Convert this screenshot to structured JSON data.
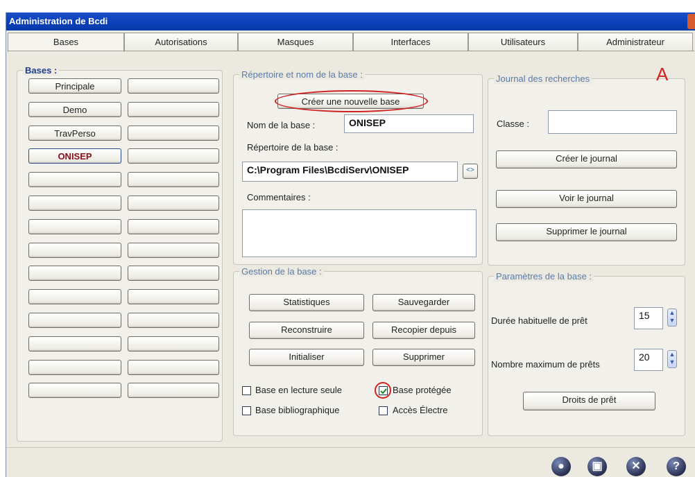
{
  "window": {
    "title": "Administration de Bcdi"
  },
  "tabs": [
    "Bases",
    "Autorisations",
    "Masques",
    "Interfaces",
    "Utilisateurs",
    "Administrateur"
  ],
  "bases_group": {
    "legend": "Bases :",
    "col1": [
      "Principale",
      "Demo",
      "TravPerso",
      "ONISEP",
      "",
      "",
      "",
      "",
      "",
      "",
      "",
      "",
      "",
      ""
    ],
    "selected": "ONISEP"
  },
  "repertoire": {
    "legend": "Répertoire et nom de la base :",
    "create_button": "Créer une nouvelle base",
    "name_label": "Nom de la base :",
    "name_value": "ONISEP",
    "dir_label": "Répertoire de la base :",
    "dir_value": "C:\\Program Files\\BcdiServ\\ONISEP",
    "browse_button": "<>",
    "comments_label": "Commentaires :",
    "comments_value": ""
  },
  "gestion": {
    "legend": "Gestion de la base :",
    "buttons": [
      "Statistiques",
      "Sauvegarder",
      "Reconstruire",
      "Recopier depuis",
      "Initialiser",
      "Supprimer"
    ],
    "checkboxes": [
      {
        "label": "Base en lecture seule",
        "checked": false
      },
      {
        "label": "Base protégée",
        "checked": true
      },
      {
        "label": "Base bibliographique",
        "checked": false
      },
      {
        "label": "Accès Électre",
        "checked": false
      }
    ]
  },
  "journal": {
    "legend": "Journal des recherches",
    "annotation": "A",
    "classe_label": "Classe :",
    "classe_value": "",
    "buttons": [
      "Créer le journal",
      "Voir le journal",
      "Supprimer le journal"
    ]
  },
  "parametres": {
    "legend": "Paramètres de la base :",
    "duree_label": "Durée habituelle de prêt",
    "duree_value": "15",
    "max_label": "Nombre maximum de prêts",
    "max_value": "20",
    "droits_button": "Droits de prêt"
  },
  "colors": {
    "title_bar": "#0a3fb8",
    "selected_text": "#8a0f18",
    "highlight_circle": "#d02222"
  },
  "footer_icons": [
    "info-icon",
    "save-icon",
    "close-icon",
    "help-icon"
  ]
}
